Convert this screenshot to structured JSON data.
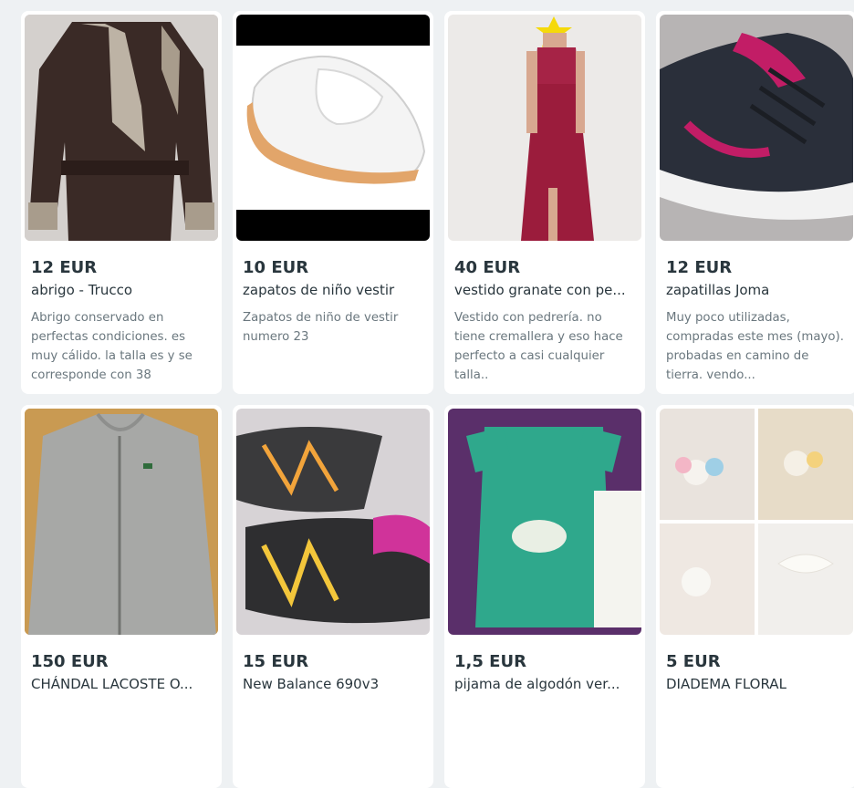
{
  "products": [
    {
      "price": "12 EUR",
      "title": "abrigo - Trucco",
      "description": "Abrigo conservado en perfectas condiciones. es muy cálido. la talla es y se corresponde con 38"
    },
    {
      "price": "10 EUR",
      "title": "zapatos de niño vestir",
      "description": "Zapatos de niño de vestir numero 23"
    },
    {
      "price": "40 EUR",
      "title": "vestido granate con pe...",
      "description": "Vestido con pedrería. no tiene cremallera y eso hace perfecto a casi cualquier talla.."
    },
    {
      "price": "12 EUR",
      "title": "zapatillas Joma",
      "description": "Muy poco utilizadas, compradas este mes (mayo). probadas en camino de tierra. vendo..."
    },
    {
      "price": "150 EUR",
      "title": "CHÁNDAL LACOSTE O...",
      "description": ""
    },
    {
      "price": "15 EUR",
      "title": "New Balance 690v3",
      "description": ""
    },
    {
      "price": "1,5 EUR",
      "title": "pijama de algodón ver...",
      "description": ""
    },
    {
      "price": "5 EUR",
      "title": "DIADEMA FLORAL",
      "description": ""
    }
  ]
}
